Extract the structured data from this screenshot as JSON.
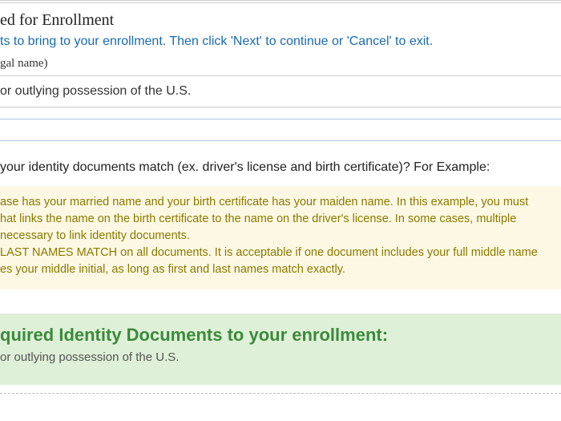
{
  "header": {
    "title_fragment": "ed for Enrollment",
    "instructions_fragment": "ts to bring to your enrollment. Then click 'Next' to continue or 'Cancel' to exit.",
    "legal_name_fragment": "gal name)"
  },
  "location_line": " or outlying possession of the U.S.",
  "match_question": " your identity documents match (ex. driver's license and birth certificate)? For Example:",
  "warning": {
    "line1": "ase has your married name and your birth certificate has your maiden name. In this example, you must",
    "line2": "hat links the name on the birth certificate to the name on the driver's license. In some cases, multiple",
    "line3": "necessary to link identity documents.",
    "line4": " LAST NAMES MATCH on all documents. It is acceptable if one document includes your full middle name",
    "line5": "es your middle initial, as long as first and last names match exactly."
  },
  "required_docs": {
    "heading_fragment": "quired Identity Documents to your enrollment:",
    "sub_fragment": " or outlying possession of the U.S."
  }
}
